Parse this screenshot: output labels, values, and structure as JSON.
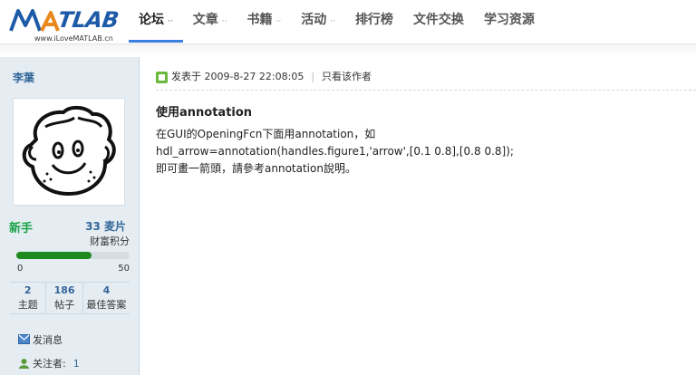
{
  "logo": {
    "wordmark": "MATLAB",
    "tagline": "www.iLoveMATLAB.cn"
  },
  "nav": {
    "items": [
      {
        "label": "论坛",
        "active": true,
        "has_dropdown": true
      },
      {
        "label": "文章",
        "has_dropdown": true
      },
      {
        "label": "书籍",
        "has_dropdown": true
      },
      {
        "label": "活动",
        "has_dropdown": true
      },
      {
        "label": "排行榜",
        "has_dropdown": false
      },
      {
        "label": "文件交换",
        "has_dropdown": false
      },
      {
        "label": "学习资源",
        "has_dropdown": false
      }
    ],
    "dropdown_glyph": "⋅⋅",
    "accent_color": "#3b7fe0"
  },
  "author": {
    "name": "李葉",
    "rank": "新手",
    "coins": "33 麦片",
    "coins_label": "财富积分",
    "progress": {
      "value": 33,
      "min": "0",
      "max": "50",
      "fraction": 0.66
    },
    "stats": [
      {
        "value": "2",
        "label": "主题"
      },
      {
        "value": "186",
        "label": "帖子"
      },
      {
        "value": "4",
        "label": "最佳答案"
      }
    ],
    "send_message": "发消息",
    "followers_label": "关注者:",
    "followers_count": "1"
  },
  "post": {
    "meta": {
      "posted_on": "发表于 2009-8-27 22:08:05",
      "only_author": "只看该作者",
      "separator": "|"
    },
    "title": "使用annotation",
    "body_lines": [
      "在GUI的OpeningFcn下面用annotation，如",
      "hdl_arrow=annotation(handles.figure1,'arrow',[0.1 0.8],[0.8 0.8]);",
      "即可畫一箭頭，請參考annotation說明。"
    ]
  }
}
